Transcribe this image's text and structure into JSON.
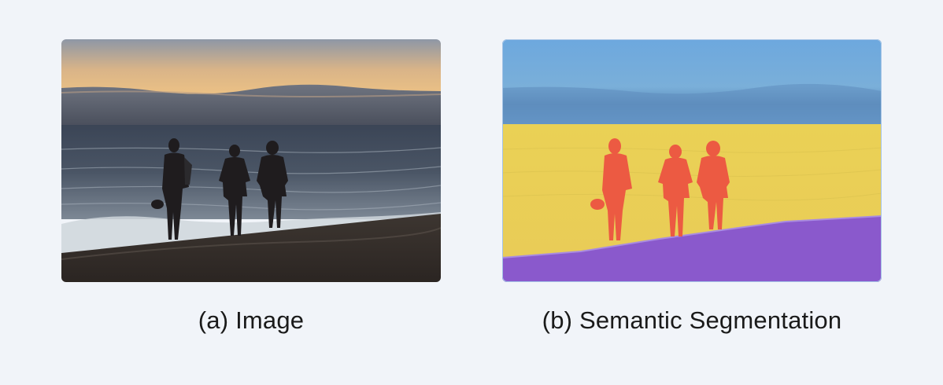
{
  "panels": [
    {
      "caption": "(a) Image",
      "content": "photograph"
    },
    {
      "caption": "(b) Semantic Segmentation",
      "content": "segmentation-mask",
      "colors": {
        "sky": "#6aa5dc",
        "sea": "#ead155",
        "sand": "#8a59cc",
        "person": "#ec5a42"
      }
    }
  ]
}
